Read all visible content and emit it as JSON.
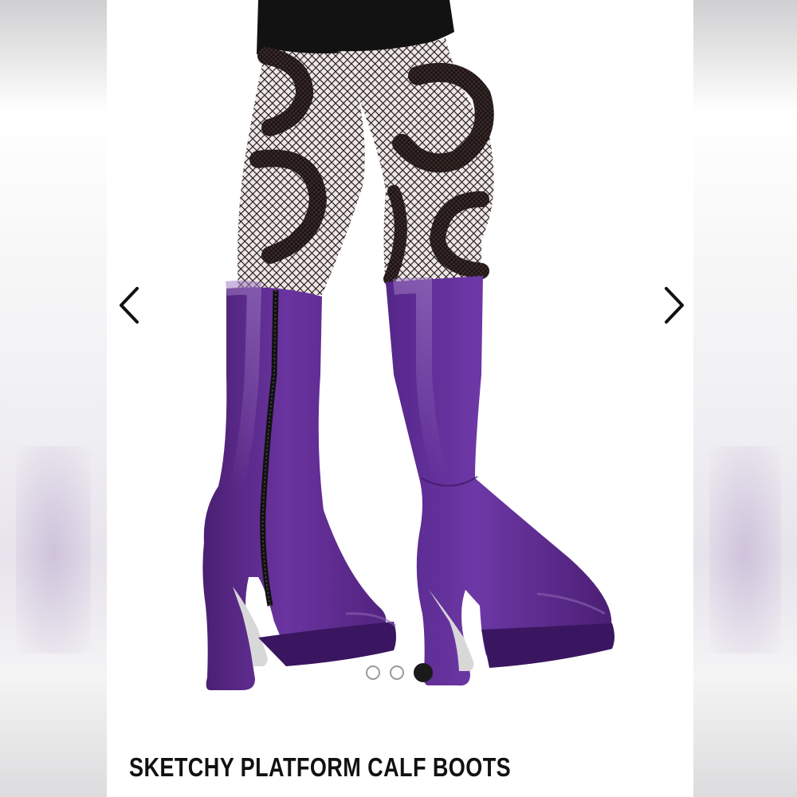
{
  "product": {
    "title": "SKETCHY PLATFORM CALF BOOTS",
    "image": {
      "alt": "purple knee-high platform boots worn with patterned fishnet tights",
      "boot_color": "#5b2a86",
      "tights_color": "#1b1414",
      "skirt_color": "#111111"
    }
  },
  "carousel": {
    "prev_icon": "chevron-left-icon",
    "next_icon": "chevron-right-icon",
    "slide_count": 3,
    "active_index": 2
  },
  "theme": {
    "card_background": "#ffffff",
    "arrow_color": "#111111",
    "dot_active": "#1a1a1a",
    "dot_inactive_border": "#9a9a9a"
  }
}
